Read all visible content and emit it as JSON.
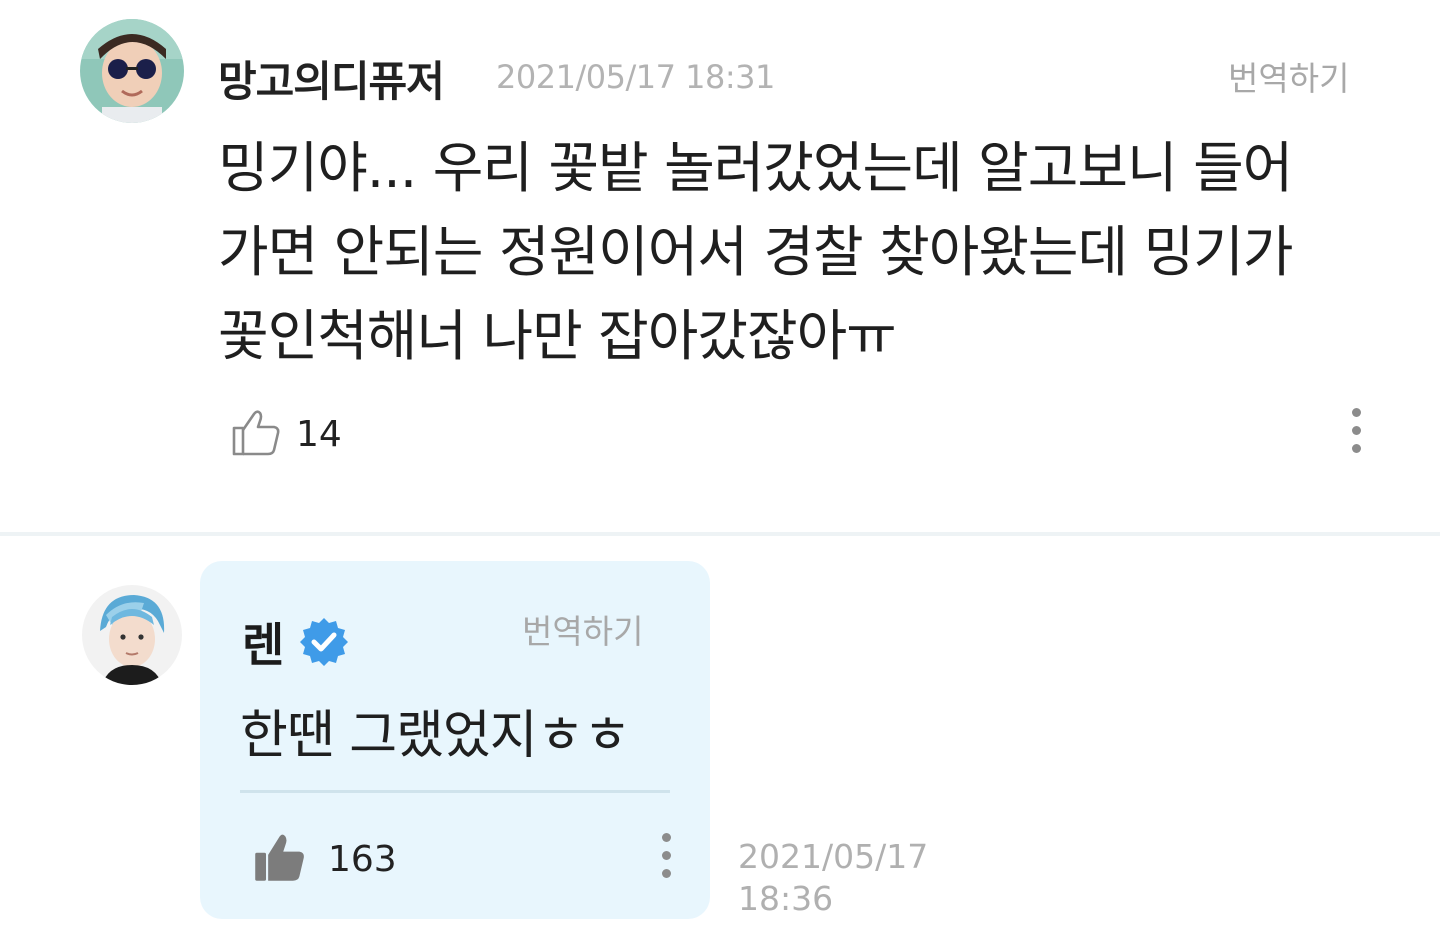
{
  "fan_comment": {
    "username": "망고의디퓨저",
    "timestamp": "2021/05/17 18:31",
    "translate_label": "번역하기",
    "body_lines": [
      "밍기야... 우리 꽃밭 놀러갔었는데 알고보니 들어",
      "가면 안되는 정원이어서 경찰 찾아왔는데 밍기가",
      "꽃인척해너 나만 잡아갔잖아ㅠ"
    ],
    "like_count": "14",
    "liked": false,
    "icons": {
      "like": "thumbs-up-outline-icon",
      "more": "more-vertical-icon"
    }
  },
  "artist_reply": {
    "username": "렌",
    "verified": true,
    "translate_label": "번역하기",
    "body": "한땐 그랬었지ㅎㅎ",
    "like_count": "163",
    "liked": true,
    "date": "2021/05/17",
    "time": "18:36",
    "icons": {
      "like": "thumbs-up-filled-icon",
      "more": "more-vertical-icon",
      "badge": "verified-badge-icon"
    }
  },
  "colors": {
    "reply_background": "#e8f6fd",
    "verified_badge": "#3f9be8",
    "muted_text": "#b3b3b3",
    "divider": "#eef3f5"
  }
}
